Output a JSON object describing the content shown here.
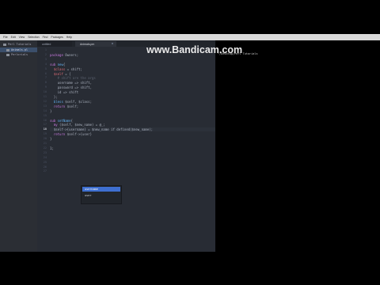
{
  "watermark": "www.Bandicam.com",
  "terminal_line": "~/Desktop/Perl Tutorials",
  "menubar": [
    "File",
    "Edit",
    "View",
    "Selection",
    "Find",
    "Packages",
    "Help"
  ],
  "sidebar": {
    "items": [
      "Perl Tutorials",
      "Animals.pl",
      "Perlorials"
    ]
  },
  "tabs": [
    "untitled",
    "Animals.pm"
  ],
  "gutter": {
    "numbers": [
      "1",
      "2",
      "3",
      "4",
      "5",
      "6",
      "7",
      "8",
      "9",
      "10",
      "11",
      "12",
      "13",
      "14",
      "15",
      "16",
      "17",
      "18",
      "19",
      "20",
      "21",
      "22",
      "23",
      "24",
      "25",
      "26",
      "27"
    ],
    "current": "18"
  },
  "code_lines": [
    [],
    [
      {
        "t": "package ",
        "c": "kw"
      },
      {
        "t": "Owners;",
        "c": ""
      }
    ],
    [],
    [
      {
        "t": "sub ",
        "c": "kw"
      },
      {
        "t": "new",
        "c": "fn"
      },
      {
        "t": "{",
        "c": ""
      }
    ],
    [
      {
        "t": "  ",
        "c": ""
      },
      {
        "t": "$class",
        "c": "var"
      },
      {
        "t": " = shift;",
        "c": ""
      }
    ],
    [
      {
        "t": "  ",
        "c": ""
      },
      {
        "t": "$self",
        "c": "var"
      },
      {
        "t": " = {",
        "c": ""
      }
    ],
    [
      {
        "t": "    # shift are the args",
        "c": "cm"
      }
    ],
    [
      {
        "t": "    username => shift,",
        "c": ""
      }
    ],
    [
      {
        "t": "    password => shift,",
        "c": ""
      }
    ],
    [
      {
        "t": "    id => shift",
        "c": ""
      }
    ],
    [
      {
        "t": "  };",
        "c": ""
      }
    ],
    [
      {
        "t": "  bless ",
        "c": "fn"
      },
      {
        "t": "$self, $class;",
        "c": ""
      }
    ],
    [
      {
        "t": "  return ",
        "c": "kw"
      },
      {
        "t": "$self;",
        "c": ""
      }
    ],
    [
      {
        "t": "}",
        "c": ""
      }
    ],
    [],
    [
      {
        "t": "sub ",
        "c": "kw"
      },
      {
        "t": "setName",
        "c": "fn"
      },
      {
        "t": "{",
        "c": ""
      }
    ],
    [
      {
        "t": "  my ",
        "c": "kw"
      },
      {
        "t": "($self, $new_name) = @_;",
        "c": ""
      }
    ],
    [
      {
        "t": "  $self->{username} = $new_name if defined($new_name);",
        "c": ""
      }
    ],
    [
      {
        "t": "  return ",
        "c": "kw"
      },
      {
        "t": "$self->{user}",
        "c": ""
      }
    ],
    [
      {
        "t": "}",
        "c": ""
      }
    ],
    [],
    [
      {
        "t": "1;",
        "c": ""
      }
    ]
  ],
  "autocomplete": {
    "items": [
      "username",
      "user"
    ],
    "selected": 0
  },
  "colors": {
    "background": "#282c34",
    "sidebar": "#2b2e34",
    "keyword": "#c678dd",
    "function": "#61afef",
    "variable": "#e06c75",
    "comment": "#5c6370",
    "selection": "#3e6fd0"
  }
}
